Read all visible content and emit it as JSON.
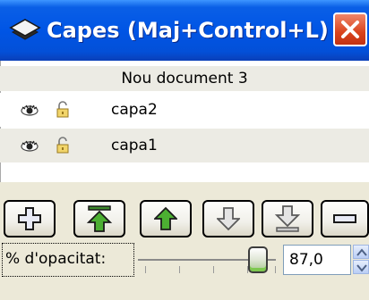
{
  "window": {
    "title": "Capes (Maj+Control+L)",
    "title_icon": "layers-icon",
    "close_icon": "close-icon",
    "accent_color": "#0055e5",
    "close_color": "#d9431d"
  },
  "layers": {
    "document_name": "Nou document 3",
    "items": [
      {
        "name": "capa2",
        "visibility_icon": "eye-icon",
        "lock_icon": "unlocked-padlock-icon",
        "selected": false
      },
      {
        "name": "capa1",
        "visibility_icon": "eye-icon",
        "lock_icon": "unlocked-padlock-icon",
        "selected": false
      }
    ]
  },
  "toolbar": {
    "buttons": [
      {
        "id": "add-layer",
        "icon": "plus-icon"
      },
      {
        "id": "raise-to-top",
        "icon": "arrow-up-to-top-icon"
      },
      {
        "id": "raise",
        "icon": "arrow-up-icon"
      },
      {
        "id": "lower",
        "icon": "arrow-down-icon"
      },
      {
        "id": "lower-to-bottom",
        "icon": "arrow-down-to-bottom-icon"
      },
      {
        "id": "delete-layer",
        "icon": "minus-icon"
      }
    ]
  },
  "opacity": {
    "label": "% d'opacitat:",
    "value_text": "87,0",
    "value": 87.0,
    "min": 0,
    "max": 100
  }
}
